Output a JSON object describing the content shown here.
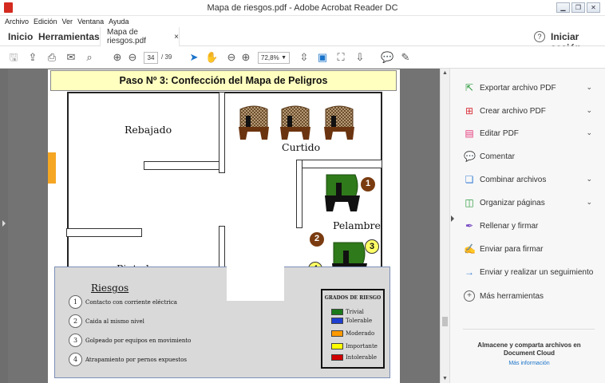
{
  "window": {
    "title": "Mapa de riesgos.pdf - Adobe Acrobat Reader DC"
  },
  "menu": [
    "Archivo",
    "Edición",
    "Ver",
    "Ventana",
    "Ayuda"
  ],
  "tabs": {
    "home": "Inicio",
    "tools": "Herramientas",
    "file": "Mapa de riesgos.pdf",
    "close": "×"
  },
  "account": {
    "help": "?",
    "signin": "Iniciar sesión"
  },
  "toolbar": {
    "page_current": "34",
    "page_total": "/ 39",
    "zoom": "72,8%"
  },
  "document": {
    "banner": "Paso Nº 3: Confección del Mapa de Peligros",
    "rooms": [
      "Rebajado",
      "Curtido",
      "Pelambre",
      "Pintado"
    ],
    "markers": [
      "1",
      "2",
      "3",
      "4"
    ],
    "riesgos_title": "Riesgos",
    "riesgos": [
      {
        "n": "1",
        "text": "Contacto con corriente eléctrica"
      },
      {
        "n": "2",
        "text": "Caida al mismo nivel"
      },
      {
        "n": "3",
        "text": "Golpeado por equipos en movimiento"
      },
      {
        "n": "4",
        "text": "Atrapamiento por pernos expuestos"
      }
    ],
    "grados_title": "GRADOS DE RIESGO",
    "grados": [
      {
        "label": "Trivial",
        "color": "#1a7a1a"
      },
      {
        "label": "Tolerable",
        "color": "#1f3fd0"
      },
      {
        "label": "Moderado",
        "color": "#ff9900"
      },
      {
        "label": "Importante",
        "color": "#ffff00"
      },
      {
        "label": "Intolerable",
        "color": "#d00000"
      }
    ]
  },
  "panel": {
    "tools": [
      {
        "label": "Exportar archivo PDF",
        "icon": "export-pdf-icon",
        "chevron": true
      },
      {
        "label": "Crear archivo PDF",
        "icon": "create-pdf-icon",
        "chevron": true
      },
      {
        "label": "Editar PDF",
        "icon": "edit-pdf-icon",
        "chevron": true
      },
      {
        "label": "Comentar",
        "icon": "comment-icon",
        "chevron": false
      },
      {
        "label": "Combinar archivos",
        "icon": "combine-icon",
        "chevron": true
      },
      {
        "label": "Organizar páginas",
        "icon": "organize-icon",
        "chevron": true
      },
      {
        "label": "Rellenar y firmar",
        "icon": "fill-sign-icon",
        "chevron": false
      },
      {
        "label": "Enviar para firmar",
        "icon": "send-sign-icon",
        "chevron": false
      },
      {
        "label": "Enviar y realizar un seguimiento",
        "icon": "send-track-icon",
        "chevron": false
      },
      {
        "label": "Más herramientas",
        "icon": "more-tools-icon",
        "chevron": false
      }
    ],
    "store_text": "Almacene y comparta archivos en Document Cloud",
    "more_info": "Más información"
  }
}
